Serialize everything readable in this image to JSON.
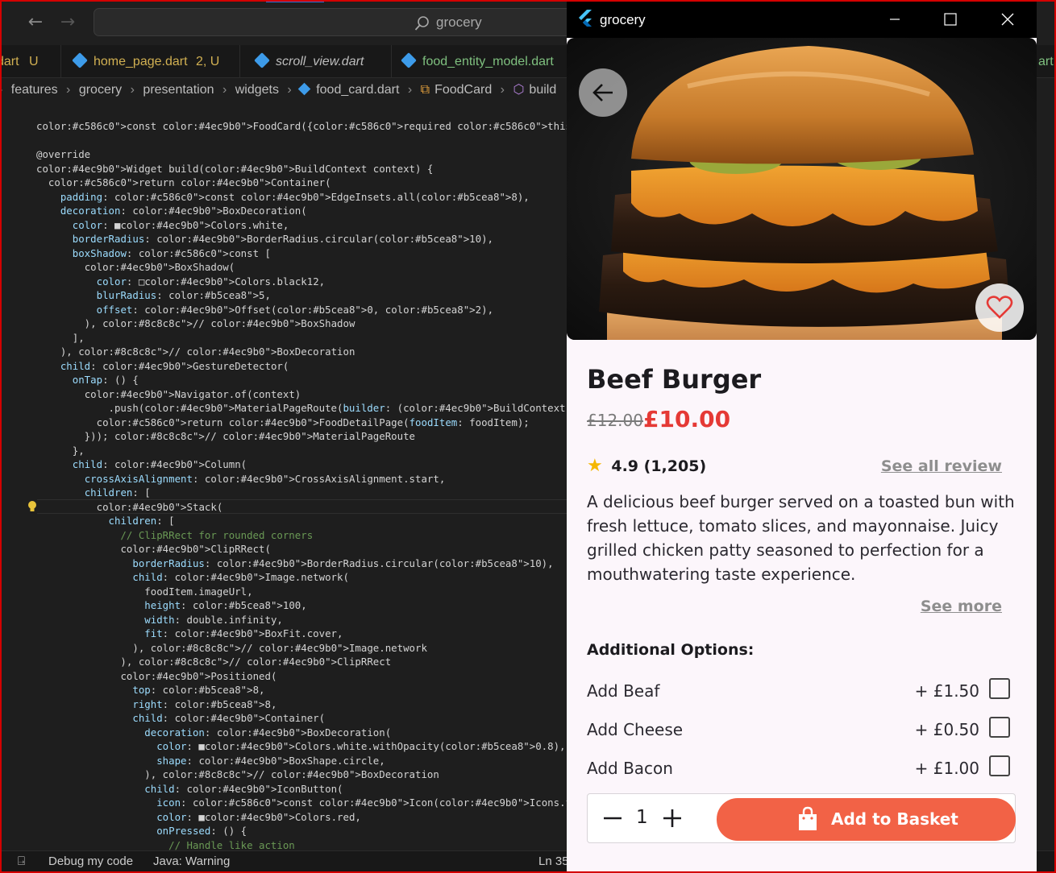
{
  "vscode": {
    "search_label": "grocery",
    "tabs": [
      {
        "label": "dart",
        "badge": "U",
        "kind": "mod"
      },
      {
        "label": "home_page.dart",
        "badge": "2, U",
        "kind": "mod"
      },
      {
        "label": "scroll_view.dart",
        "badge": "",
        "kind": "plain"
      },
      {
        "label": "food_entity_model.dart",
        "badge": "",
        "kind": "green"
      },
      {
        "label": "art",
        "badge": "",
        "kind": "green"
      }
    ],
    "breadcrumb": [
      "features",
      "grocery",
      "presentation",
      "widgets",
      "food_card.dart",
      "FoodCard",
      "build"
    ],
    "code_lines": [
      "const FoodCard({required this.foodItem, super.key});",
      "",
      "@override",
      "Widget build(BuildContext context) {",
      "  return Container(",
      "    padding: const EdgeInsets.all(8),",
      "    decoration: BoxDecoration(",
      "      color: ■Colors.white,",
      "      borderRadius: BorderRadius.circular(10),",
      "      boxShadow: const [",
      "        BoxShadow(",
      "          color: □Colors.black12,",
      "          blurRadius: 5,",
      "          offset: Offset(0, 2),",
      "        ), // BoxShadow",
      "      ],",
      "    ), // BoxDecoration",
      "    child: GestureDetector(",
      "      onTap: () {",
      "        Navigator.of(context)",
      "            .push(MaterialPageRoute(builder: (BuildContext context) {",
      "          return FoodDetailPage(foodItem: foodItem);",
      "        })); // MaterialPageRoute",
      "      },",
      "      child: Column(",
      "        crossAxisAlignment: CrossAxisAlignment.start,",
      "        children: [",
      "          Stack(",
      "            children: [",
      "              // ClipRRect for rounded corners",
      "              ClipRRect(",
      "                borderRadius: BorderRadius.circular(10),",
      "                child: Image.network(",
      "                  foodItem.imageUrl,",
      "                  height: 100,",
      "                  width: double.infinity,",
      "                  fit: BoxFit.cover,",
      "                ), // Image.network",
      "              ), // ClipRRect",
      "              Positioned(",
      "                top: 8,",
      "                right: 8,",
      "                child: Container(",
      "                  decoration: BoxDecoration(",
      "                    color: ■Colors.white.withOpacity(0.8),",
      "                    shape: BoxShape.circle,",
      "                  ), // BoxDecoration",
      "                  child: IconButton(",
      "                    icon: const Icon(Icons.favorite_border),",
      "                    color: ■Colors.red,",
      "                    onPressed: () {",
      "                      // Handle like action"
    ],
    "status": {
      "debug": "Debug my code",
      "java": "Java: Warning",
      "position": "Ln 35"
    }
  },
  "flutter_window": {
    "title": "grocery",
    "product": {
      "name": "Beef Burger",
      "old_price": "£12.00",
      "price": "£10.00",
      "rating": "4.9",
      "reviews": "(1,205)",
      "see_all_review": "See all review",
      "description": "A delicious beef burger served on a toasted bun with fresh lettuce, tomato slices, and mayonnaise. Juicy grilled chicken patty seasoned to perfection for a mouthwatering taste experience.",
      "see_more": "See more"
    },
    "additional_options_label": "Additional Options:",
    "options": [
      {
        "name": "Add Beaf",
        "price": "+ £1.50",
        "checked": false
      },
      {
        "name": "Add Cheese",
        "price": "+ £0.50",
        "checked": false
      },
      {
        "name": "Add Bacon",
        "price": "+ £1.00",
        "checked": false
      }
    ],
    "quantity": "1",
    "add_to_basket": "Add to Basket",
    "colors": {
      "accent": "#f26246",
      "price": "#e53935",
      "star": "#f5b700"
    }
  }
}
